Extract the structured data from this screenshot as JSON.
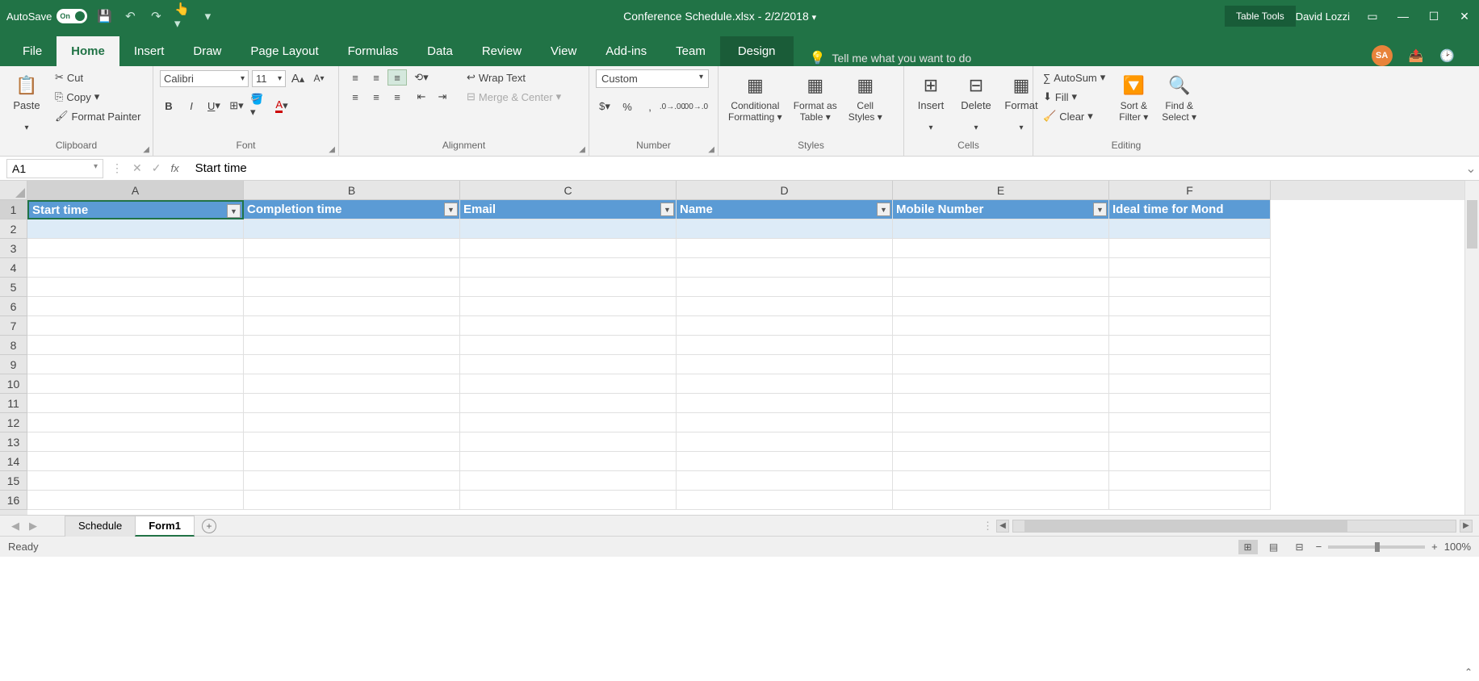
{
  "titlebar": {
    "autosave_label": "AutoSave",
    "autosave_on": "On",
    "document_title": "Conference Schedule.xlsx - 2/2/2018",
    "table_tools": "Table Tools",
    "user": "David Lozzi",
    "avatar_initials": "SA"
  },
  "tabs": {
    "file": "File",
    "home": "Home",
    "insert": "Insert",
    "draw": "Draw",
    "page_layout": "Page Layout",
    "formulas": "Formulas",
    "data": "Data",
    "review": "Review",
    "view": "View",
    "addins": "Add-ins",
    "team": "Team",
    "design": "Design",
    "tell_me": "Tell me what you want to do"
  },
  "ribbon": {
    "clipboard": {
      "label": "Clipboard",
      "paste": "Paste",
      "cut": "Cut",
      "copy": "Copy",
      "format_painter": "Format Painter"
    },
    "font": {
      "label": "Font",
      "name": "Calibri",
      "size": "11"
    },
    "alignment": {
      "label": "Alignment",
      "wrap": "Wrap Text",
      "merge": "Merge & Center"
    },
    "number": {
      "label": "Number",
      "format": "Custom"
    },
    "styles": {
      "label": "Styles",
      "cond": "Conditional Formatting",
      "table": "Format as Table",
      "cell": "Cell Styles"
    },
    "cells": {
      "label": "Cells",
      "insert": "Insert",
      "delete": "Delete",
      "format": "Format"
    },
    "editing": {
      "label": "Editing",
      "autosum": "AutoSum",
      "fill": "Fill",
      "clear": "Clear",
      "sort": "Sort & Filter",
      "find": "Find & Select"
    }
  },
  "formula_bar": {
    "cell_ref": "A1",
    "value": "Start time"
  },
  "grid": {
    "columns": [
      "A",
      "B",
      "C",
      "D",
      "E",
      "F"
    ],
    "rows": [
      "1",
      "2",
      "3",
      "4",
      "5",
      "6",
      "7",
      "8",
      "9",
      "10",
      "11",
      "12",
      "13",
      "14",
      "15",
      "16"
    ],
    "headers": [
      "Start time",
      "Completion time",
      "Email",
      "Name",
      "Mobile Number",
      "Ideal time for Mond"
    ]
  },
  "sheets": {
    "schedule": "Schedule",
    "form1": "Form1"
  },
  "statusbar": {
    "ready": "Ready",
    "zoom": "100%"
  }
}
